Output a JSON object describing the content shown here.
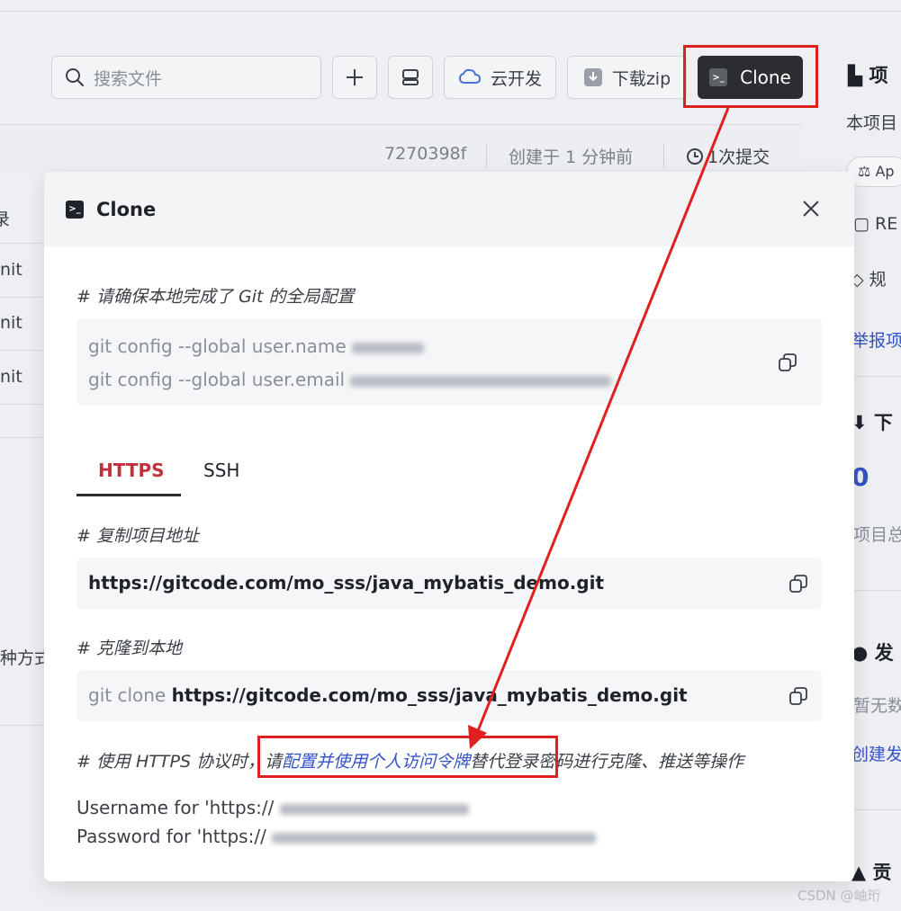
{
  "toolbar": {
    "search_placeholder": "搜索文件",
    "add_label": "+",
    "cloud_dev_label": "云开发",
    "download_label": "下载zip",
    "clone_label": "Clone"
  },
  "commit_bar": {
    "hash": "7270398f",
    "created": "创建于 1 分钟前",
    "commit_count": "1次提交"
  },
  "left_fragments": [
    "录",
    "nit",
    "nit",
    "nit",
    "种方式"
  ],
  "right_sidebar": {
    "project_heading": "项",
    "project_intro": "本项目",
    "license_badge": "Ap",
    "readme_item": "RE",
    "rules_item": "规",
    "report_link": "举报项",
    "download_heading": "下",
    "download_count": "0",
    "project_total": "项目总",
    "release_heading": "发",
    "no_release": "暂无数",
    "create_release": "创建发",
    "contributors_heading": "贡"
  },
  "modal": {
    "title": "Clone",
    "git_config_comment": "# 请确保本地完成了 Git 的全局配置",
    "git_config_name_cmd": "git config --global user.name",
    "git_config_email_cmd": "git config --global user.email",
    "tabs": [
      "HTTPS",
      "SSH"
    ],
    "active_tab": "HTTPS",
    "copy_url_comment": "# 复制项目地址",
    "repo_url": "https://gitcode.com/mo_sss/java_mybatis_demo.git",
    "clone_comment": "# 克隆到本地",
    "clone_cmd_prefix": "git clone",
    "clone_cmd_url": "https://gitcode.com/mo_sss/java_mybatis_demo.git",
    "https_note_prefix": "# 使用 HTTPS 协议时，请",
    "https_note_link": "配置并使用个人访问令牌",
    "https_note_suffix": "替代登录密码进行克隆、推送等操作",
    "username_prompt": "Username for 'https://",
    "password_prompt": "Password for 'https://"
  },
  "watermark": "CSDN @岫珩",
  "colors": {
    "annotation_red": "#e02020",
    "active_tab_red": "#c0303d",
    "link_blue": "#3553c8",
    "clone_button_bg": "#2b2d31"
  }
}
